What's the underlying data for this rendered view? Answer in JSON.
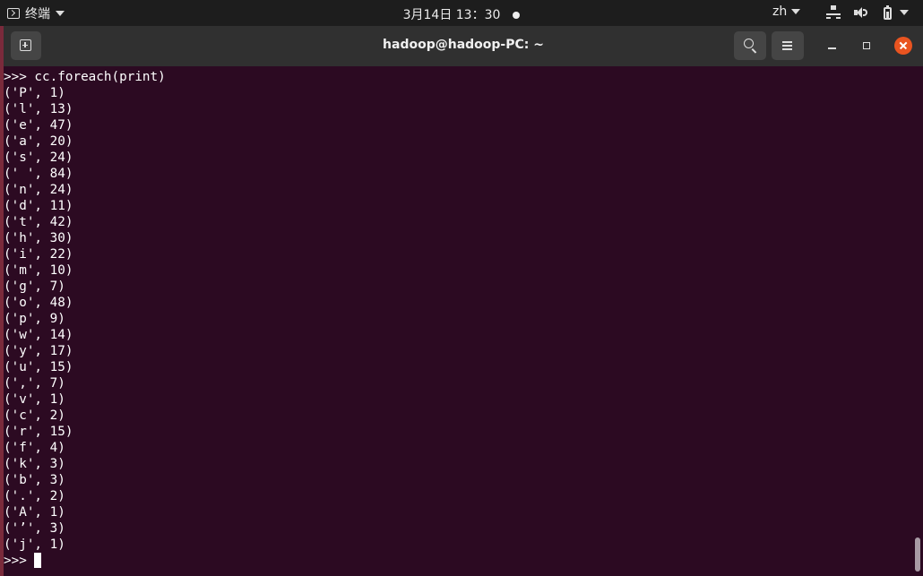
{
  "topbar": {
    "app_name": "终端",
    "clock": "3月14日  13：30",
    "language": "zh"
  },
  "window": {
    "title": "hadoop@hadoop-PC: ~"
  },
  "terminal": {
    "command_line": ">>> cc.foreach(print)",
    "output_lines": [
      "('P', 1)",
      "('l', 13)",
      "('e', 47)",
      "('a', 20)",
      "('s', 24)",
      "(' ', 84)",
      "('n', 24)",
      "('d', 11)",
      "('t', 42)",
      "('h', 30)",
      "('i', 22)",
      "('m', 10)",
      "('g', 7)",
      "('o', 48)",
      "('p', 9)",
      "('w', 14)",
      "('y', 17)",
      "('u', 15)",
      "(',', 7)",
      "('v', 1)",
      "('c', 2)",
      "('r', 15)",
      "('f', 4)",
      "('k', 3)",
      "('b', 3)",
      "('.', 2)",
      "('A', 1)",
      "('’', 3)",
      "('j', 1)"
    ],
    "prompt": ">>> "
  },
  "colors": {
    "terminal_background": "#2c0a22",
    "header_background": "#303030",
    "topbar_background": "#1d1d1d",
    "close_button": "#e95420"
  },
  "icons": [
    "terminal-app-icon",
    "network-icon",
    "volume-icon",
    "battery-icon",
    "new-tab-icon",
    "search-icon",
    "hamburger-icon",
    "minimize-icon",
    "maximize-icon",
    "close-icon"
  ]
}
